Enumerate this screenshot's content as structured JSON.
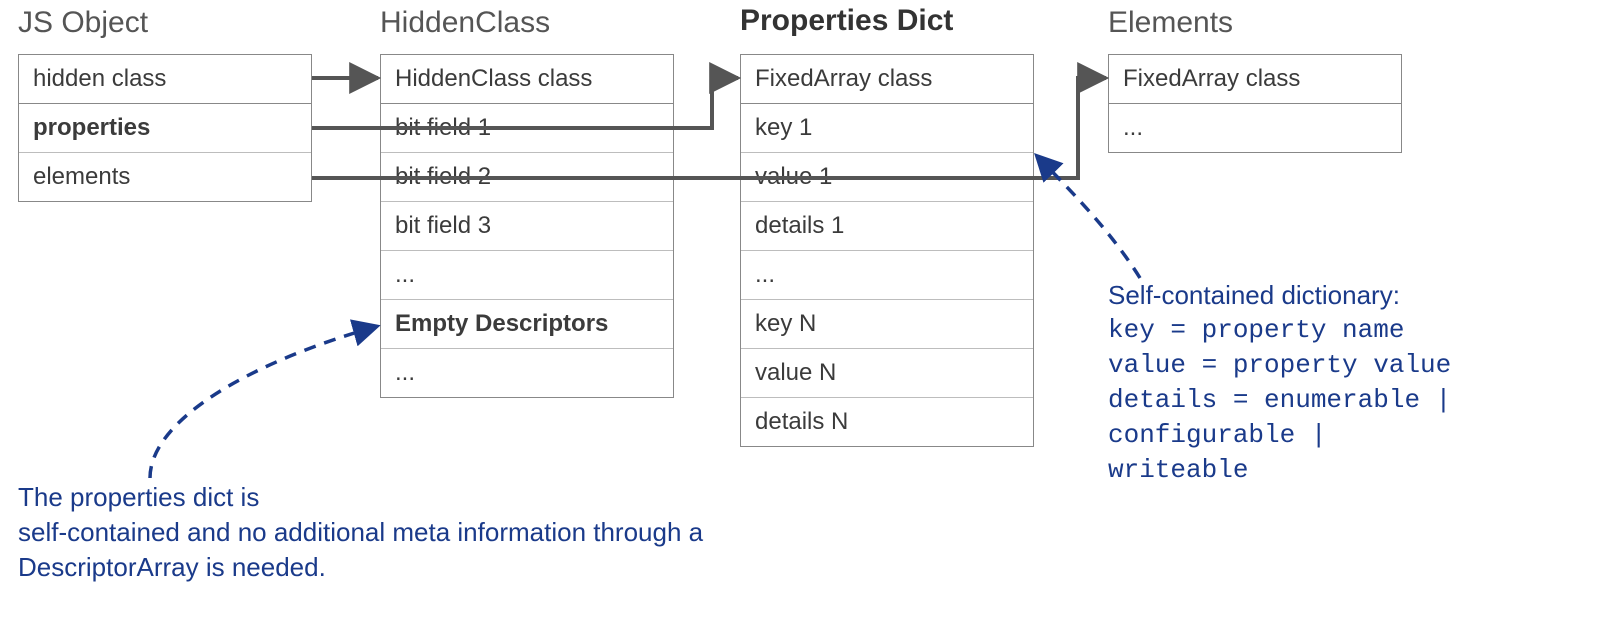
{
  "titles": {
    "jsObject": "JS Object",
    "hiddenClass": "HiddenClass",
    "propertiesDict": "Properties Dict",
    "elements": "Elements"
  },
  "jsObject": {
    "r0": "hidden class",
    "r1": "properties",
    "r2": "elements"
  },
  "hiddenClass": {
    "r0": "HiddenClass class",
    "r1": "bit field 1",
    "r2": "bit field 2",
    "r3": "bit field 3",
    "r4": "...",
    "r5": "Empty Descriptors",
    "r6": "..."
  },
  "propertiesDict": {
    "r0": "FixedArray class",
    "r1": "key 1",
    "r2": "value 1",
    "r3": "details 1",
    "r4": "...",
    "r5": "key N",
    "r6": "value N",
    "r7": "details N"
  },
  "elementsBox": {
    "r0": "FixedArray class",
    "r1": "..."
  },
  "annotations": {
    "leftTop": "The properties dict is",
    "leftBottom": "self-contained and no additional meta information through a DescriptorArray is needed.",
    "rightTitle": "Self-contained dictionary:",
    "kv_key": "key     = property name",
    "kv_value": "value   = property value",
    "kv_details_l1": "details = enumerable   |",
    "kv_details_l2": "          configurable |",
    "kv_details_l3": "          writeable"
  }
}
